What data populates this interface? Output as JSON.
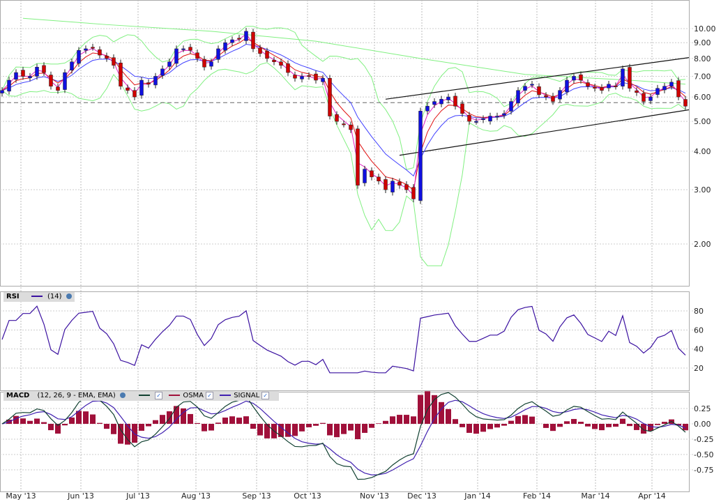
{
  "chart_data": {
    "type": "candlestick",
    "title": "",
    "sample_step_note": "each value ~2.5 trading days",
    "closes": [
      6.3,
      6.8,
      7.2,
      7.0,
      7.0,
      7.5,
      7.2,
      6.5,
      6.3,
      7.2,
      7.8,
      8.5,
      8.6,
      8.7,
      8.2,
      8.0,
      7.6,
      6.5,
      6.3,
      6.0,
      6.8,
      6.6,
      7.0,
      7.4,
      7.8,
      8.6,
      8.6,
      8.5,
      8.0,
      7.5,
      7.8,
      8.6,
      9.0,
      9.2,
      9.3,
      9.8,
      8.6,
      8.3,
      8.0,
      7.8,
      7.6,
      7.2,
      6.9,
      7.0,
      7.0,
      6.8,
      6.9,
      5.2,
      5.0,
      4.9,
      4.7,
      3.1,
      3.5,
      3.3,
      3.2,
      3.0,
      3.2,
      3.1,
      3.0,
      2.8,
      5.4,
      5.6,
      5.8,
      5.9,
      6.0,
      5.6,
      5.3,
      5.0,
      5.0,
      5.1,
      5.2,
      5.2,
      5.3,
      5.8,
      6.3,
      6.5,
      6.6,
      6.1,
      6.0,
      5.8,
      6.3,
      6.8,
      7.0,
      6.8,
      6.5,
      6.4,
      6.3,
      6.6,
      6.5,
      7.4,
      6.4,
      6.2,
      5.8,
      6.0,
      6.4,
      6.5,
      6.7,
      6.0,
      5.6
    ],
    "long_ma": {
      "indices": [
        3,
        15,
        30,
        45,
        60,
        75,
        90,
        98
      ],
      "values": [
        10.8,
        10.3,
        9.8,
        9.1,
        8.0,
        7.1,
        6.8,
        6.6
      ]
    },
    "reference_line": 5.75,
    "trendlines": [
      {
        "name": "channel-upper",
        "from": [
          55,
          5.9
        ],
        "to": [
          98.5,
          8.05
        ]
      },
      {
        "name": "channel-lower",
        "from": [
          57,
          3.88
        ],
        "to": [
          98.5,
          5.45
        ]
      }
    ],
    "price_axis": {
      "scale": "log",
      "ticks": [
        "10.00",
        "9.00",
        "8.00",
        "7.00",
        "6.00",
        "5.00",
        "4.00",
        "3.00",
        "2.00"
      ]
    },
    "x_ticks": [
      {
        "label": "May '13",
        "index": 2.7
      },
      {
        "label": "Jun '13",
        "index": 11.3
      },
      {
        "label": "Jul '13",
        "index": 19.5
      },
      {
        "label": "Aug '13",
        "index": 27.8
      },
      {
        "label": "Sep '13",
        "index": 36.5
      },
      {
        "label": "Oct '13",
        "index": 43.8
      },
      {
        "label": "Nov '13",
        "index": 53.4
      },
      {
        "label": "Dec '13",
        "index": 60.2
      },
      {
        "label": "Jan '14",
        "index": 68.2
      },
      {
        "label": "Feb '14",
        "index": 76.7
      },
      {
        "label": "Mar '14",
        "index": 85.1
      },
      {
        "label": "Apr '14",
        "index": 93.2
      }
    ],
    "rsi": {
      "label": "RSI",
      "params": "(14)",
      "ticks": [
        "80",
        "60",
        "40",
        "20"
      ]
    },
    "macd": {
      "label": "MACD",
      "params": "(12, 26, 9 - EMA, EMA)",
      "osma": "OSMA",
      "signal": "SIGNAL",
      "ticks": [
        "0.25",
        "0.00",
        "-0.25",
        "-0.50",
        "-0.75"
      ]
    },
    "colors": {
      "up": "#1010e0",
      "down": "#d00000",
      "ema_fast": "#e020c0",
      "ema_mid": "#e01010",
      "ema_slow": "#4040ff",
      "bands": "#80f080",
      "rsi": "#3a10a0",
      "macd": "#104030",
      "osma": "#a0103a",
      "signal": "#4020b0"
    }
  }
}
